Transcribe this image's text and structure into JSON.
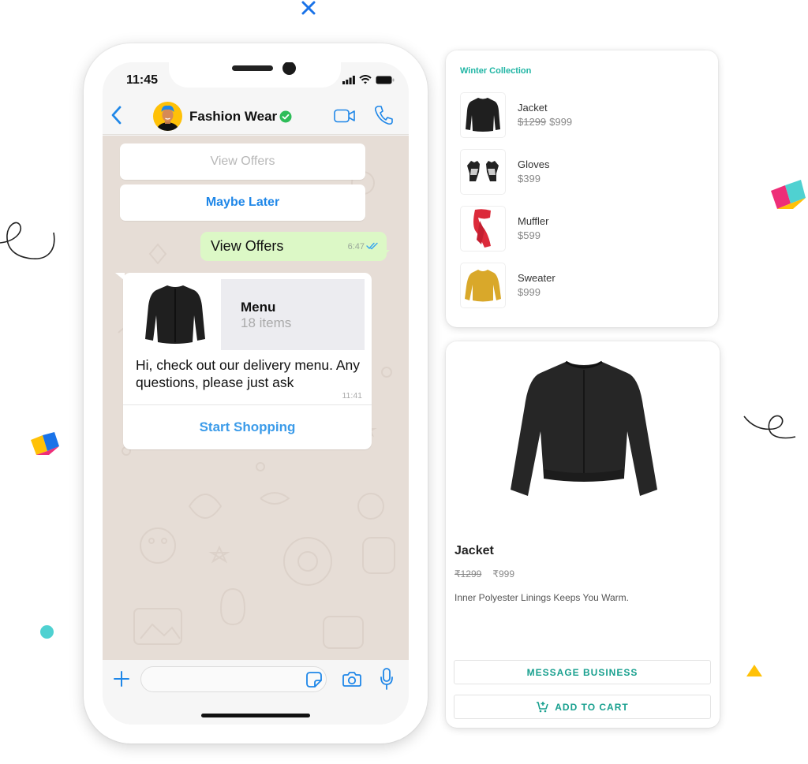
{
  "phone": {
    "status_bar": {
      "time": "11:45"
    },
    "chat_header": {
      "contact_name": "Fashion Wear",
      "verified": true
    },
    "quick_replies": [
      {
        "label": "View Offers",
        "state": "disabled"
      },
      {
        "label": "Maybe Later",
        "state": "active"
      }
    ],
    "outgoing_message": {
      "text": "View Offers",
      "time": "6:47",
      "status": "read"
    },
    "catalog_message": {
      "title": "Menu",
      "subtitle": "18 items",
      "text": "Hi, check out our delivery menu. Any questions, please just ask",
      "time": "11:41",
      "action_label": "Start Shopping"
    },
    "input_bar": {
      "placeholder": ""
    }
  },
  "collection": {
    "title": "Winter Collection",
    "items": [
      {
        "name": "Jacket",
        "old_price": "$1299",
        "price": "$999",
        "thumb": "jacket"
      },
      {
        "name": "Gloves",
        "old_price": "",
        "price": "$399",
        "thumb": "gloves"
      },
      {
        "name": "Muffler",
        "old_price": "",
        "price": "$599",
        "thumb": "muffler"
      },
      {
        "name": "Sweater",
        "old_price": "",
        "price": "$999",
        "thumb": "sweater"
      }
    ]
  },
  "product_detail": {
    "name": "Jacket",
    "old_price": "₹1299",
    "price": "₹999",
    "description": "Inner Polyester Linings Keeps You Warm.",
    "message_button": "MESSAGE BUSINESS",
    "cart_button": "ADD TO CART"
  },
  "colors": {
    "ios_blue": "#1f87e8",
    "outgoing_bubble": "#dcf8c6",
    "chat_background": "#e6ddd6",
    "accent_teal": "#19a08f",
    "verified_green": "#2ebd59"
  }
}
